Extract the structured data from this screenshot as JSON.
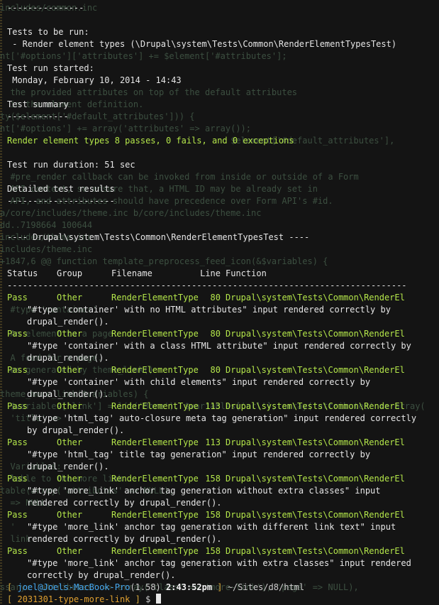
{
  "ghost_lines": [
    "includes/common.inc",
    "nt['#options']['attributes'] += $element['#attributes'];",
    "  the provided attributes on top of the default attributes",
    "  in the element definition.",
    "ty($element['#default_attributes'])) {",
    "nt['#options'] += array('attributes' => array());",
    "                                             $element['#default_attributes'],",
    "  #pre_render callback can be invoked from inside or outside of a Form",
    "  API context, so ensure that, a HTML ID may be already set in",
    "  API, and attributes should have precedence over Form API's #id.",
    "a/core/includes/theme.inc b/core/includes/theme.inc",
    "dd..7198664 100644",
    "includes/theme.inc",
    "includes/theme.inc",
    "+1847,6 @@ function template_preprocess_feed_icon(&$variables) {",
    "  #type 'container'",
    "  An element to a page.",
    "  A feed for a page.",
    "  as generated by theme_link()",
    "theme_more_link($variables) {",
    "  $variables['link'] = l(t('More'), $variables['url'], array('attributes' => array(",
    "  'title' => ''",
    "  ",
    "  Variables:",
    "  lable to the more link",
    "table(array('attributes' => NULL),",
    "  => NULL,",
    "  ' ",
    "  link",
    "  ' ",
    "  ",
    "ssary: 'attributes' => array('class' => 'more-link'), 'page' => NULL),",
    "  "
  ],
  "lines": [
    {
      "text": "---------------",
      "cls": ""
    },
    {
      "text": "",
      "cls": ""
    },
    {
      "text": "Tests to be run:",
      "cls": ""
    },
    {
      "text": " - Render element types (\\Drupal\\system\\Tests\\Common\\RenderElementTypesTest)",
      "cls": ""
    },
    {
      "text": "",
      "cls": ""
    },
    {
      "text": "Test run started:",
      "cls": ""
    },
    {
      "text": " Monday, February 10, 2014 - 14:43",
      "cls": ""
    },
    {
      "text": "",
      "cls": ""
    },
    {
      "text": "Test summary",
      "cls": ""
    },
    {
      "text": "------------",
      "cls": ""
    },
    {
      "text": "",
      "cls": ""
    },
    {
      "text": "Render element types 8 passes, 0 fails, and 0 exceptions",
      "cls": "green"
    },
    {
      "text": "",
      "cls": ""
    },
    {
      "text": "Test run duration: 51 sec",
      "cls": ""
    },
    {
      "text": "",
      "cls": ""
    },
    {
      "text": "Detailed test results",
      "cls": ""
    },
    {
      "text": "---------------------",
      "cls": ""
    },
    {
      "text": "",
      "cls": ""
    },
    {
      "text": "",
      "cls": ""
    },
    {
      "text": "---- Drupal\\system\\Tests\\Common\\RenderElementTypesTest ----",
      "cls": ""
    },
    {
      "text": "",
      "cls": ""
    },
    {
      "text": "",
      "cls": ""
    }
  ],
  "table": {
    "headers": {
      "status": "Status",
      "group": "Group",
      "filename": "Filename",
      "line": "Line",
      "function": "Function"
    },
    "rule": "------------------------------------------------------------------------------",
    "rows": [
      {
        "status": "Pass",
        "group": "Other",
        "filename": "RenderElementType",
        "line": "80",
        "function": "Drupal\\system\\Tests\\Common\\RenderEl",
        "message": [
          "\"#type 'container' with no HTML attributes\" input rendered correctly by",
          "drupal_render()."
        ]
      },
      {
        "status": "Pass",
        "group": "Other",
        "filename": "RenderElementType",
        "line": "80",
        "function": "Drupal\\system\\Tests\\Common\\RenderEl",
        "message": [
          "\"#type 'container' with a class HTML attribute\" input rendered correctly by",
          "drupal_render()."
        ]
      },
      {
        "status": "Pass",
        "group": "Other",
        "filename": "RenderElementType",
        "line": "80",
        "function": "Drupal\\system\\Tests\\Common\\RenderEl",
        "message": [
          "\"#type 'container' with child elements\" input rendered correctly by",
          "drupal_render()."
        ]
      },
      {
        "status": "Pass",
        "group": "Other",
        "filename": "RenderElementType",
        "line": "113",
        "function": "Drupal\\system\\Tests\\Common\\RenderEl",
        "message": [
          "\"#type 'html_tag' auto-closure meta tag generation\" input rendered correctly",
          "by drupal_render()."
        ]
      },
      {
        "status": "Pass",
        "group": "Other",
        "filename": "RenderElementType",
        "line": "113",
        "function": "Drupal\\system\\Tests\\Common\\RenderEl",
        "message": [
          "\"#type 'html_tag' title tag generation\" input rendered correctly by",
          "drupal_render()."
        ]
      },
      {
        "status": "Pass",
        "group": "Other",
        "filename": "RenderElementType",
        "line": "158",
        "function": "Drupal\\system\\Tests\\Common\\RenderEl",
        "message": [
          "\"#type 'more_link' anchor tag generation without extra classes\" input",
          "rendered correctly by drupal_render()."
        ]
      },
      {
        "status": "Pass",
        "group": "Other",
        "filename": "RenderElementType",
        "line": "158",
        "function": "Drupal\\system\\Tests\\Common\\RenderEl",
        "message": [
          "\"#type 'more_link' anchor tag generation with different link text\" input",
          "rendered correctly by drupal_render()."
        ]
      },
      {
        "status": "Pass",
        "group": "Other",
        "filename": "RenderElementType",
        "line": "158",
        "function": "Drupal\\system\\Tests\\Common\\RenderEl",
        "message": [
          "\"#type 'more_link' anchor tag generation with extra classes\" input rendered",
          "correctly by drupal_render()."
        ]
      }
    ]
  },
  "prompt": {
    "open": "[",
    "user_host": "joel@Joels-MacBook-Pro",
    "ruby": "(1.58)",
    "time": "2:43:52pm",
    "close": "]",
    "path": "~/Sites/d8/html",
    "branch_open": "[",
    "branch": "2031301-type-more-link",
    "branch_close": "]",
    "symbol": "$"
  },
  "colors": {
    "background": "#141414",
    "text": "#e6e6e6",
    "pass_green": "#b4e64a",
    "prompt_user": "#46a8f0",
    "prompt_bracket": "#d6a93c",
    "branch": "#e0a030"
  }
}
